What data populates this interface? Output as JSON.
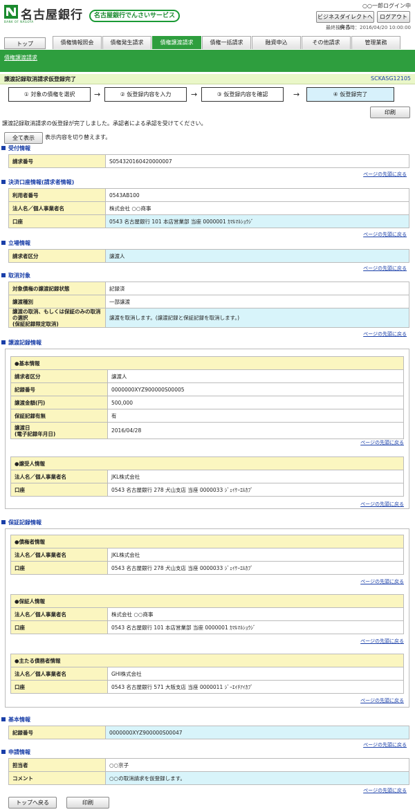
{
  "header": {
    "bank_name": "名古屋銀行",
    "bank_sub": "BANK OF NAGOYA",
    "service_name": "名古屋銀行でんさいサービス",
    "user": "○○一郎ログイン中",
    "business_direct": "ビジネスダイレクトへ戻る",
    "logout": "ログアウト",
    "last_operation": "最終操作日時：2016/04/20 10:00:00"
  },
  "nav": {
    "top": "トップ",
    "tabs": [
      "債権情報照会",
      "債権発生請求",
      "債権譲渡請求",
      "債権一括請求",
      "融資申込",
      "その他請求",
      "管理業務"
    ],
    "sub": "債権譲渡請求"
  },
  "title": {
    "text": "譲渡記録取消請求仮登録完了",
    "id": "SCKASG12105"
  },
  "steps": [
    "① 対象の債権を選択",
    "② 仮登録内容を入力",
    "③ 仮登録内容を確認",
    "④ 仮登録完了"
  ],
  "actions": {
    "print": "印刷",
    "show_all": "全て表示",
    "toggle_text": "表示内容を切り替えます。",
    "back_top": "トップへ戻る"
  },
  "message": "譲渡記録取消請求の仮登録が完了しました。承認者による承認を受けてください。",
  "page_top": "ページの先頭に戻る",
  "receipt": {
    "title": "受付情報",
    "rows": [
      [
        "請求番号",
        "S054320160420000007"
      ]
    ]
  },
  "account": {
    "title": "決済口座情報(請求者情報)",
    "rows": [
      [
        "利用者番号",
        "0543AB100"
      ],
      [
        "法人名／個人事業者名",
        "株式会社 ○○商事"
      ],
      [
        "口座",
        "0543 名古屋銀行 101 本店営業部 当座 0000001 ｶﾏﾙﾏﾙｼｮｳｼﾞ"
      ]
    ]
  },
  "position": {
    "title": "立場情報",
    "rows": [
      [
        "請求者区分",
        "譲渡人"
      ]
    ]
  },
  "cancel": {
    "title": "取消対象",
    "rows": [
      [
        "対象債権の譲渡記録状態",
        "記録済"
      ],
      [
        "譲渡種別",
        "一部譲渡"
      ],
      [
        "譲渡の取消、もしくは保証のみの取消の選択\n(保証記録限定取消)",
        "譲渡を取消します。(譲渡記録と保証記録を取消します。)"
      ]
    ]
  },
  "transfer": {
    "title": "譲渡記録情報",
    "basic_title": "●基本情報",
    "basic": [
      [
        "請求者区分",
        "譲渡人"
      ],
      [
        "記録番号",
        "0000000XYZ900000S00005"
      ],
      [
        "譲渡金額(円)",
        "500,000"
      ],
      [
        "保証記録有無",
        "有"
      ],
      [
        "譲渡日\n(電子記録年月日)",
        "2016/04/28"
      ]
    ],
    "receiver_title": "●譲受人情報",
    "receiver": [
      [
        "法人名／個人事業者名",
        "JKL株式会社"
      ],
      [
        "口座",
        "0543 名古屋銀行 278 犬山支店 当座 0000033 ｼﾞｪｲｹｰｴﾙｶﾌﾞ"
      ]
    ]
  },
  "guarantee": {
    "title": "保証記録情報",
    "creditor_title": "●債権者情報",
    "creditor": [
      [
        "法人名／個人事業者名",
        "JKL株式会社"
      ],
      [
        "口座",
        "0543 名古屋銀行 278 犬山支店 当座 0000033 ｼﾞｪｲｹｰｴﾙｶﾌﾞ"
      ]
    ],
    "guarantor_title": "●保証人情報",
    "guarantor": [
      [
        "法人名／個人事業者名",
        "株式会社 ○○商事"
      ],
      [
        "口座",
        "0543 名古屋銀行 101 本店営業部 当座 0000001 ｶﾏﾙﾏﾙｼｮｳｼﾞ"
      ]
    ],
    "main_title": "●主たる債務者情報",
    "main": [
      [
        "法人名／個人事業者名",
        "GHI株式会社"
      ],
      [
        "口座",
        "0543 名古屋銀行 571 大阪支店 当座 0000011 ｼﾞｰｴｲﾁｱｲｶﾌﾞ"
      ]
    ]
  },
  "basic": {
    "title": "基本情報",
    "rows": [
      [
        "記録番号",
        "0000000XYZ900000S00047"
      ]
    ]
  },
  "request": {
    "title": "申請情報",
    "rows": [
      [
        "担当者",
        "○○京子"
      ],
      [
        "コメント",
        "○○の取消請求を仮登録します。"
      ]
    ]
  }
}
